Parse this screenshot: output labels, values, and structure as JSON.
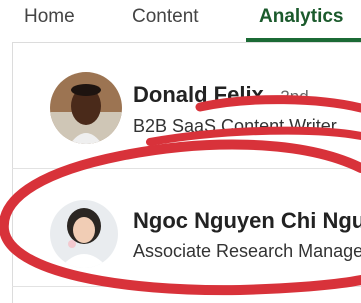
{
  "tabs": [
    {
      "label": "Home",
      "active": false
    },
    {
      "label": "Content",
      "active": false
    },
    {
      "label": "Analytics",
      "active": true
    }
  ],
  "people": [
    {
      "name": "Donald Felix",
      "degree": "· 2nd",
      "headline": "B2B SaaS Content Writer"
    },
    {
      "name": "Ngoc Nguyen Chi Nguyen",
      "degree": "",
      "headline": "Associate Research Manager"
    }
  ],
  "colors": {
    "accent": "#1b5a2c",
    "annotation_red": "#d8323a"
  }
}
